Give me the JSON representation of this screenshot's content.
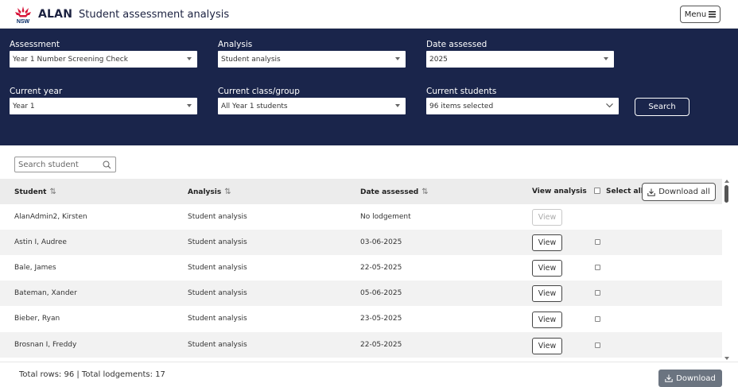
{
  "header": {
    "brand": "ALAN",
    "title": "Student assessment analysis",
    "logo_text": "NSW",
    "menu_label": "Menu"
  },
  "filters": {
    "assessment": {
      "label": "Assessment",
      "value": "Year 1 Number Screening Check"
    },
    "analysis": {
      "label": "Analysis",
      "value": "Student analysis"
    },
    "date_assessed": {
      "label": "Date assessed",
      "value": "2025"
    },
    "current_year": {
      "label": "Current year",
      "value": "Year 1"
    },
    "current_class": {
      "label": "Current class/group",
      "value": "All Year 1 students"
    },
    "current_students": {
      "label": "Current students",
      "value": "96 items selected"
    },
    "search_label": "Search"
  },
  "search": {
    "placeholder": "Search student"
  },
  "table": {
    "columns": {
      "student": "Student",
      "analysis": "Analysis",
      "date": "Date assessed",
      "view": "View analysis",
      "select_all": "Select all"
    },
    "download_all_label": "Download all",
    "view_label": "View",
    "rows": [
      {
        "student": "AlanAdmin2, Kirsten",
        "analysis": "Student analysis",
        "date": "No lodgement"
      },
      {
        "student": "Astin I, Audree",
        "analysis": "Student analysis",
        "date": "03-06-2025"
      },
      {
        "student": "Bale, James",
        "analysis": "Student analysis",
        "date": "22-05-2025"
      },
      {
        "student": "Bateman, Xander",
        "analysis": "Student analysis",
        "date": "05-06-2025"
      },
      {
        "student": "Bieber, Ryan",
        "analysis": "Student analysis",
        "date": "23-05-2025"
      },
      {
        "student": "Brosnan I, Freddy",
        "analysis": "Student analysis",
        "date": "22-05-2025"
      }
    ]
  },
  "footer": {
    "totals": "Total rows: 96 | Total lodgements: 17",
    "download_label": "Download"
  },
  "colors": {
    "panel_bg": "#1a254b",
    "nsw_red": "#d7153a",
    "nsw_navy": "#002664"
  }
}
